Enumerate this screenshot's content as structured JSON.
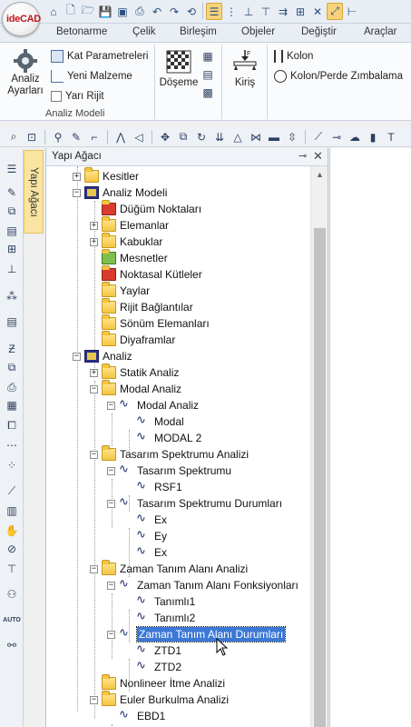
{
  "app": {
    "logo_text": "ideCAD",
    "accent": "#c0161b",
    "selection_color": "#3b78d6"
  },
  "quick_access": {
    "icons": [
      "home-icon",
      "new-file-icon",
      "open-folder-icon",
      "save-icon",
      "save-as-icon",
      "print-icon",
      "undo-icon",
      "redo-icon",
      "refresh-icon",
      "layers-icon",
      "grid-icon",
      "point-snap-icon",
      "perpendicular-icon",
      "midpoint-icon",
      "intersection-icon",
      "tangent-icon",
      "snap-active-icon",
      "extend-icon"
    ]
  },
  "ribbon_tabs": [
    "Betonarme",
    "Çelik",
    "Birleşim",
    "Objeler",
    "Değiştir",
    "Araçlar"
  ],
  "ribbon": {
    "analysis_settings_label_1": "Analiz",
    "analysis_settings_label_2": "Ayarları",
    "kat_parametreleri": "Kat Parametreleri",
    "yeni_malzeme": "Yeni Malzeme",
    "yari_rijit": "Yarı Rijit",
    "group_label": "Analiz Modeli",
    "doseme": "Döşeme",
    "kiris": "Kiriş",
    "kolon": "Kolon",
    "kolon_perde": "Kolon/Perde Zımbalama"
  },
  "panel": {
    "vertical_tab": "Yapı Ağacı",
    "title": "Yapı Ağacı",
    "pin": "⊸",
    "close": "✕"
  },
  "tree": [
    {
      "label": "Kesitler"
    },
    {
      "label": "Analiz Modeli"
    },
    {
      "label": "Düğüm Noktaları"
    },
    {
      "label": "Elemanlar"
    },
    {
      "label": "Kabuklar"
    },
    {
      "label": "Mesnetler"
    },
    {
      "label": "Noktasal Kütleler"
    },
    {
      "label": "Yaylar"
    },
    {
      "label": "Rijit Bağlantılar"
    },
    {
      "label": "Sönüm Elemanları"
    },
    {
      "label": "Diyaframlar"
    },
    {
      "label": "Analiz"
    },
    {
      "label": "Statik Analiz"
    },
    {
      "label": "Modal Analiz"
    },
    {
      "label": "Modal Analiz"
    },
    {
      "label": "Modal"
    },
    {
      "label": "MODAL 2"
    },
    {
      "label": "Tasarım Spektrumu Analizi"
    },
    {
      "label": "Tasarım Spektrumu"
    },
    {
      "label": "RSF1"
    },
    {
      "label": "Tasarım Spektrumu Durumları"
    },
    {
      "label": "Ex"
    },
    {
      "label": "Ey"
    },
    {
      "label": "Ex"
    },
    {
      "label": "Zaman Tanım Alanı Analizi"
    },
    {
      "label": "Zaman Tanım Alanı Fonksiyonları"
    },
    {
      "label": "Tanımlı1"
    },
    {
      "label": "Tanımlı2"
    },
    {
      "label": "Zaman Tanım Alanı Durumları"
    },
    {
      "label": "ZTD1"
    },
    {
      "label": "ZTD2"
    },
    {
      "label": "Nonlineer İtme Analizi"
    },
    {
      "label": "Euler Burkulma Analizi"
    },
    {
      "label": "EBD1"
    }
  ]
}
